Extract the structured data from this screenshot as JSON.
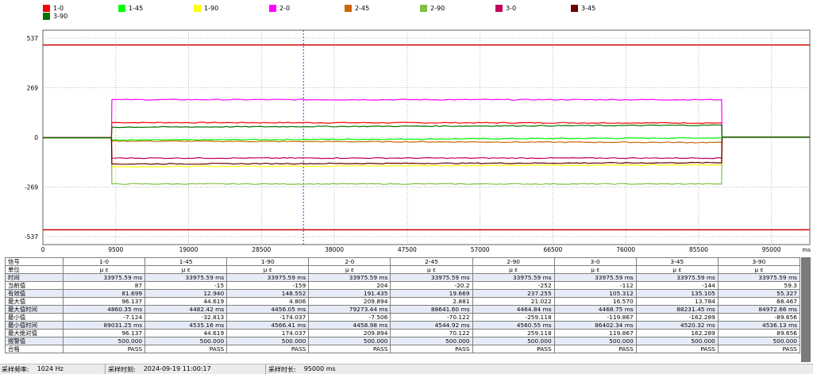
{
  "chart_data": {
    "type": "line",
    "title": "",
    "xlabel": "",
    "ylabel": "",
    "x_unit": "ms",
    "xlim": [
      0,
      100000
    ],
    "ylim": [
      -580,
      580
    ],
    "x_ticks": [
      0,
      9500,
      19000,
      28500,
      38000,
      47500,
      57000,
      66500,
      76000,
      85500,
      95000
    ],
    "x_tick_labels": [
      "0",
      "9500",
      "19000",
      "28500",
      "38000",
      "47500",
      "57000",
      "66500",
      "76000",
      "85500",
      "95000"
    ],
    "y_ticks": [
      537,
      269,
      0,
      -269,
      -537
    ],
    "y_tick_labels": [
      "537",
      "269",
      "0",
      "-269",
      "-537"
    ],
    "grid": true,
    "cursor_x": 33975.59,
    "alarm_lines": [
      500,
      -500
    ],
    "alarm_color": "#cc0000",
    "legend_position": "top",
    "series": [
      {
        "name": "1-0",
        "color": "#ff0000",
        "pre": -2,
        "start": 9000,
        "active": 80,
        "end": 88500,
        "active_end": 78,
        "post": 2
      },
      {
        "name": "1-45",
        "color": "#00ff00",
        "pre": -2,
        "start": 9000,
        "active": -15,
        "end": 88500,
        "active_end": -3,
        "post": 2
      },
      {
        "name": "1-90",
        "color": "#ffff00",
        "pre": -1,
        "start": 9000,
        "active": -159,
        "end": 88500,
        "active_end": -148,
        "post": 1
      },
      {
        "name": "2-0",
        "color": "#ff00ff",
        "pre": -1,
        "start": 9000,
        "active": 204,
        "end": 88500,
        "active_end": 204,
        "post": 1
      },
      {
        "name": "2-45",
        "color": "#cc6600",
        "pre": -2,
        "start": 9000,
        "active": -20,
        "end": 88500,
        "active_end": -28,
        "post": 1
      },
      {
        "name": "2-90",
        "color": "#80c040",
        "pre": -2,
        "start": 9000,
        "active": -252,
        "end": 88500,
        "active_end": -252,
        "post": 2
      },
      {
        "name": "3-0",
        "color": "#c0005a",
        "pre": -1,
        "start": 9000,
        "active": -112,
        "end": 88500,
        "active_end": -112,
        "post": 1
      },
      {
        "name": "3-45",
        "color": "#6a0000",
        "pre": -1,
        "start": 9000,
        "active": -144,
        "end": 88500,
        "active_end": -137,
        "post": 1
      },
      {
        "name": "3-90",
        "color": "#007000",
        "pre": -2,
        "start": 9000,
        "active": 55,
        "end": 88500,
        "active_end": 66,
        "post": 0
      }
    ]
  },
  "table": {
    "headers": [
      "信号",
      "1-0",
      "1-45",
      "1-90",
      "2-0",
      "2-45",
      "2-90",
      "3-0",
      "3-45",
      "3-90"
    ],
    "rows": [
      {
        "label": "单位",
        "cells": [
          "μ ε",
          "μ ε",
          "μ ε",
          "μ ε",
          "μ ε",
          "μ ε",
          "μ ε",
          "μ ε",
          "μ ε"
        ]
      },
      {
        "label": "时间",
        "cells": [
          "33975.59 ms",
          "33975.59 ms",
          "33975.59 ms",
          "33975.59 ms",
          "33975.59 ms",
          "33975.59 ms",
          "33975.59 ms",
          "33975.59 ms",
          "33975.59 ms"
        ]
      },
      {
        "label": "当前值",
        "cells": [
          "87",
          "-15",
          "-159",
          "204",
          "-20.2",
          "-252",
          "-112",
          "-144",
          "59.3"
        ]
      },
      {
        "label": "有效值",
        "cells": [
          "81.699",
          "12.940",
          "148.552",
          "191.435",
          "19.669",
          "237.255",
          "105.312",
          "135.105",
          "55.327"
        ]
      },
      {
        "label": "最大值",
        "cells": [
          "96.137",
          "44.619",
          "4.806",
          "209.894",
          "2.881",
          "21.022",
          "16.570",
          "13.784",
          "68.467"
        ]
      },
      {
        "label": "最大值时间",
        "cells": [
          "4860.35 ms",
          "4482.42 ms",
          "4456.05 ms",
          "79273.44 ms",
          "88641.60 ms",
          "4464.84 ms",
          "4468.75 ms",
          "88231.45 ms",
          "84972.66 ms"
        ]
      },
      {
        "label": "最小值",
        "cells": [
          "-7.124",
          "-32.813",
          "-174.037",
          "-7.506",
          "-70.122",
          "-259.118",
          "-119.867",
          "-162.289",
          "-89.656"
        ]
      },
      {
        "label": "最小值时间",
        "cells": [
          "89031.25 ms",
          "4535.16 ms",
          "4566.41 ms",
          "4458.98 ms",
          "4544.92 ms",
          "4560.55 ms",
          "86402.34 ms",
          "4520.32 ms",
          "4536.13 ms"
        ]
      },
      {
        "label": "最大绝对值",
        "cells": [
          "96.137",
          "44.619",
          "174.037",
          "209.894",
          "70.122",
          "259.118",
          "119.867",
          "162.289",
          "89.656"
        ]
      },
      {
        "label": "报警值",
        "cells": [
          "500.000",
          "500.000",
          "500.000",
          "500.000",
          "500.000",
          "500.000",
          "500.000",
          "500.000",
          "500.000"
        ]
      },
      {
        "label": "合格",
        "cells": [
          "PASS",
          "PASS",
          "PASS",
          "PASS",
          "PASS",
          "PASS",
          "PASS",
          "PASS",
          "PASS"
        ]
      }
    ]
  },
  "status": {
    "sample_rate_label": "采样频率:",
    "sample_rate_value": "1024  Hz",
    "sample_time_label": "采样时刻:",
    "sample_time_value": "2024-09-19  11:00:17",
    "sample_duration_label": "采样时长:",
    "sample_duration_value": "95000  ms"
  }
}
